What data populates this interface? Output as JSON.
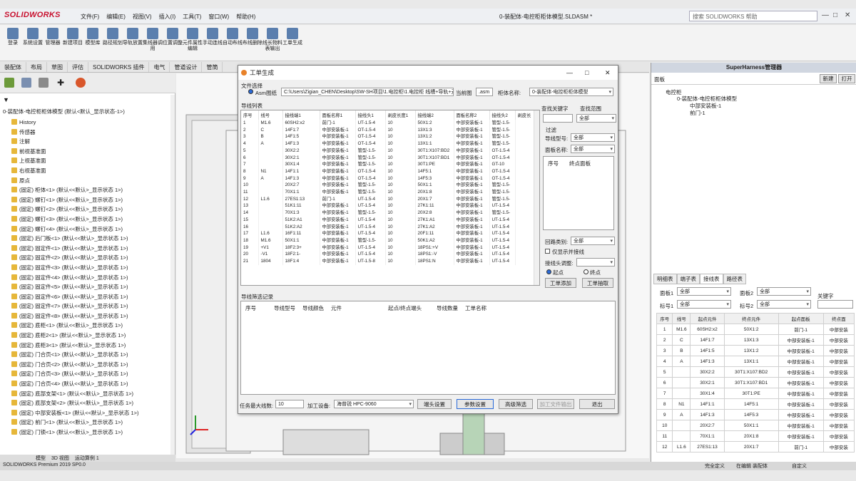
{
  "app": {
    "name": "SOLIDWORKS",
    "doc_title": "0-装配体-电控柜柜体模型.SLDASM *",
    "search_placeholder": "搜索 SOLIDWORKS 帮助",
    "version": "SOLIDWORKS Premium 2019 SP0.0"
  },
  "menus": [
    "文件(F)",
    "编辑(E)",
    "视图(V)",
    "插入(I)",
    "工具(T)",
    "窗口(W)",
    "帮助(H)"
  ],
  "ribbon": [
    "登录",
    "系统设置",
    "管理器",
    "新建项目",
    "模型库",
    "路径规划",
    "导轨放置",
    "集线器调用",
    "位置调整",
    "元件属性编辑",
    "手动连线",
    "自动布线",
    "布线删除",
    "线长物料表输出",
    "工单生成"
  ],
  "tabs": [
    "装配体",
    "布局",
    "草图",
    "评估",
    "SOLIDWORKS 插件",
    "电气",
    "管道设计",
    "管筒"
  ],
  "tree": {
    "root": "0-装配体-电控柜柜体模型 (默认<默认_显示状态-1>)",
    "items": [
      "History",
      "传感器",
      "注解",
      "前视基准面",
      "上视基准面",
      "右视基准面",
      "原点",
      "(固定) 柜体<1> (默认<<默认>_显示状态 1>)",
      "(固定) 螺钉<1> (默认<<默认>_显示状态 1>)",
      "(固定) 螺钉<2> (默认<<默认>_显示状态 1>)",
      "(固定) 螺钉<3> (默认<<默认>_显示状态 1>)",
      "(固定) 螺钉<4> (默认<<默认>_显示状态 1>)",
      "(固定) 后门板<1> (默认<<默认>_显示状态 1>)",
      "(固定) 固定件<1> (默认<<默认>_显示状态 1>)",
      "(固定) 固定件<2> (默认<<默认>_显示状态 1>)",
      "(固定) 固定件<3> (默认<<默认>_显示状态 1>)",
      "(固定) 固定件<4> (默认<<默认>_显示状态 1>)",
      "(固定) 固定件<5> (默认<<默认>_显示状态 1>)",
      "(固定) 固定件<6> (默认<<默认>_显示状态 1>)",
      "(固定) 固定件<7> (默认<<默认>_显示状态 1>)",
      "(固定) 固定件<8> (默认<<默认>_显示状态 1>)",
      "(固定) 底柜<1> (默认<<默认>_显示状态 1>)",
      "(固定) 底柜2<1> (默认<<默认>_显示状态 1>)",
      "(固定) 底柜3<1> (默认<<默认>_显示状态 1>)",
      "(固定) 门合页<1> (默认<<默认>_显示状态 1>)",
      "(固定) 门合页<2> (默认<<默认>_显示状态 1>)",
      "(固定) 门合页<3> (默认<<默认>_显示状态 1>)",
      "(固定) 门合页<4> (默认<<默认>_显示状态 1>)",
      "(固定) 底部支架<1> (默认<<默认>_显示状态 1>)",
      "(固定) 底部支架<2> (默认<<默认>_显示状态 1>)",
      "(固定) 中部安装板<1> (默认<<默认>_显示状态 1>)",
      "(固定) 前门<1> (默认<<默认>_显示状态 1>)",
      "(固定) 门锁<1> (默认<<默认>_显示状态 1>)"
    ],
    "bottom_tabs": [
      "模型",
      "3D 视图",
      "运动算例 1"
    ]
  },
  "dialog": {
    "title": "工单生成",
    "file_section": "文件选择",
    "radio_asm": "Asm图纸",
    "path": "C:\\Users\\Zigian_CHEN\\Desktop\\SW-SH项目\\1.电控柜\\1.电控柜 线槽+导轨+元件",
    "current_btn": "当前图",
    "ext": ".asm",
    "cabinet_label": "柜体名称:",
    "cabinet_value": "0-装配体-电控柜柜体模型",
    "wirelist_label": "导线列表",
    "columns": [
      "序号",
      "线号",
      "接线端1",
      "面板名称1",
      "接线头1",
      "剥皮长度1",
      "接线端2",
      "面板名称2",
      "接线头2",
      "剥皮长"
    ],
    "rows": [
      [
        "1",
        "M1.6",
        "60SH2:x2",
        "前门-1",
        "UT-1.5-4",
        "10",
        "50X1:2",
        "中部安装板-1",
        "管型-1.5-"
      ],
      [
        "2",
        "C",
        "14F1:7",
        "中部安装板-1",
        "OT-1.5-4",
        "10",
        "13X1:3",
        "中部安装板-1",
        "管型-1.5-"
      ],
      [
        "3",
        "B",
        "14F1:5",
        "中部安装板-1",
        "OT-1.5-4",
        "10",
        "13X1:2",
        "中部安装板-1",
        "管型-1.5-"
      ],
      [
        "4",
        "A",
        "14F1:3",
        "中部安装板-1",
        "OT-1.5-4",
        "10",
        "13X1:1",
        "中部安装板-1",
        "管型-1.5-"
      ],
      [
        "5",
        "",
        "30X2:2",
        "中部安装板-1",
        "管型-1.5-",
        "10",
        "30T1:X107:BD2",
        "中部安装板-1",
        "OT-1.5-4"
      ],
      [
        "6",
        "",
        "30X2:1",
        "中部安装板-1",
        "管型-1.5-",
        "10",
        "30T1:X107:BD1",
        "中部安装板-1",
        "OT-1.5-4"
      ],
      [
        "7",
        "",
        "30X1:4",
        "中部安装板-1",
        "管型-1.5-",
        "10",
        "30T1:PE",
        "中部安装板-1",
        "GT-10"
      ],
      [
        "8",
        "N1",
        "14F1:1",
        "中部安装板-1",
        "OT-1.5-4",
        "10",
        "14F5:1",
        "中部安装板-1",
        "OT-1.5-4"
      ],
      [
        "9",
        "A",
        "14F1:3",
        "中部安装板-1",
        "OT-1.5-4",
        "10",
        "14F5:3",
        "中部安装板-1",
        "OT-1.5-4"
      ],
      [
        "10",
        "",
        "20X2:7",
        "中部安装板-1",
        "管型-1.5-",
        "10",
        "50X1:1",
        "中部安装板-1",
        "管型-1.5-"
      ],
      [
        "11",
        "",
        "70X1:1",
        "中部安装板-1",
        "管型-1.5-",
        "10",
        "20X1:8",
        "中部安装板-1",
        "管型-1.5-"
      ],
      [
        "12",
        "L1.6",
        "27ES1:13",
        "前门-1",
        "UT-1.5-4",
        "10",
        "20X1:7",
        "中部安装板-1",
        "管型-1.5-"
      ],
      [
        "13",
        "",
        "51K1:11",
        "中部安装板-1",
        "UT-1.5-4",
        "10",
        "27K1:11",
        "中部安装板-1",
        "UT-1.5-4"
      ],
      [
        "14",
        "",
        "70X1:3",
        "中部安装板-1",
        "管型-1.5-",
        "10",
        "20X2:8",
        "中部安装板-1",
        "管型-1.5-"
      ],
      [
        "15",
        "",
        "51K2:A1",
        "中部安装板-1",
        "UT-1.5-4",
        "10",
        "27K1:A1",
        "中部安装板-1",
        "UT-1.5-4"
      ],
      [
        "16",
        "",
        "51K2:A2",
        "中部安装板-1",
        "UT-1.5-4",
        "10",
        "27K1:A2",
        "中部安装板-1",
        "UT-1.5-4"
      ],
      [
        "17",
        "L1.6",
        "16F1:11",
        "中部安装板-1",
        "UT-1.5-4",
        "10",
        "20F1:11",
        "中部安装板-1",
        "UT-1.5-4"
      ],
      [
        "18",
        "M1.6",
        "50X1:1",
        "中部安装板-1",
        "管型-1.5-",
        "10",
        "50K1:A2",
        "中部安装板-1",
        "UT-1.5-4"
      ],
      [
        "19",
        "+V1",
        "18F2:3+",
        "中部安装板-1",
        "UT-1.5-4",
        "10",
        "18PS1:+V",
        "中部安装板-1",
        "UT-1.5-4"
      ],
      [
        "20",
        "-V1",
        "18F2:1-",
        "中部安装板-1",
        "UT-1.5-4",
        "10",
        "18PS1:-V",
        "中部安装板-1",
        "UT-1.5-4"
      ],
      [
        "21",
        "1804",
        "18F1:4",
        "中部安装板-1",
        "UT-1.5-8",
        "10",
        "18PS1:N",
        "中部安装板-1",
        "UT-1.5-4"
      ]
    ],
    "filter": {
      "search_key": "查找关键字",
      "search_range": "查找范围",
      "range_value": "全部",
      "filter": "过滤",
      "wire_type": "导线型号:",
      "wire_type_value": "全部",
      "panel_name": "面板名称:",
      "panel_value": "全部",
      "col_seq": "序号",
      "col_end": "终点面板",
      "loop_type": "回路类别:",
      "loop_value": "全部",
      "only_parallel": "仅显示并接线",
      "adjust": "接线头调整:",
      "start": "起点",
      "end": "终点",
      "add": "工单添加",
      "extract": "工单抽取"
    },
    "record_label": "导线筛选记录",
    "record_cols": [
      "序号",
      "导线型号",
      "导线颜色",
      "元件",
      "起点/终点端头",
      "导线数量",
      "工单名称"
    ],
    "max_wires_label": "任务最大线数:",
    "max_wires": "10",
    "device_label": "加工设备:",
    "device": "海普锐 HPC-9060",
    "buttons": [
      "端头设置",
      "参数设置",
      "高级筛选",
      "加工文件输出",
      "退出"
    ]
  },
  "right": {
    "title": "SuperHarness管理器",
    "sub": "面板",
    "new": "新建",
    "open": "打开",
    "tree": [
      "电控柜",
      "0-装配体-电控柜柜体模型",
      "中部安装板-1",
      "前门-1"
    ],
    "tabs": [
      "明细表",
      "端子表",
      "接线表",
      "路径表"
    ],
    "filter": {
      "p1": "面板1",
      "p1v": "全部",
      "p2": "面板2",
      "p2v": "全部",
      "k": "关键字",
      "t1": "标号1",
      "t1v": "全部",
      "t2": "标号2",
      "t2v": "全部"
    },
    "cols": [
      "序号",
      "线号",
      "起点元件",
      "终点元件",
      "起点面板",
      "终点面"
    ],
    "rows": [
      [
        "1",
        "M1.6",
        "60SH2:x2",
        "50X1:2",
        "前门-1",
        "中部安装"
      ],
      [
        "2",
        "C",
        "14F1:7",
        "13X1:3",
        "中部安装板-1",
        "中部安装"
      ],
      [
        "3",
        "B",
        "14F1:5",
        "13X1:2",
        "中部安装板-1",
        "中部安装"
      ],
      [
        "4",
        "A",
        "14F1:3",
        "13X1:1",
        "中部安装板-1",
        "中部安装"
      ],
      [
        "5",
        "",
        "30X2:2",
        "30T1:X107:BD2",
        "中部安装板-1",
        "中部安装"
      ],
      [
        "6",
        "",
        "30X2:1",
        "30T1:X107:BD1",
        "中部安装板-1",
        "中部安装"
      ],
      [
        "7",
        "",
        "30X1:4",
        "30T1:PE",
        "中部安装板-1",
        "中部安装"
      ],
      [
        "8",
        "N1",
        "14F1:1",
        "14F5:1",
        "中部安装板-1",
        "中部安装"
      ],
      [
        "9",
        "A",
        "14F1:3",
        "14F5:3",
        "中部安装板-1",
        "中部安装"
      ],
      [
        "10",
        "",
        "20X2:7",
        "50X1:1",
        "中部安装板-1",
        "中部安装"
      ],
      [
        "11",
        "",
        "70X1:1",
        "20X1:8",
        "中部安装板-1",
        "中部安装"
      ],
      [
        "12",
        "L1.6",
        "27ES1:13",
        "20X1:7",
        "前门-1",
        "中部安装"
      ]
    ]
  },
  "status": {
    "left": "SOLIDWORKS Premium 2019 SP0.0",
    "s1": "完全定义",
    "s2": "在编辑 装配体",
    "s3": "自定义"
  }
}
